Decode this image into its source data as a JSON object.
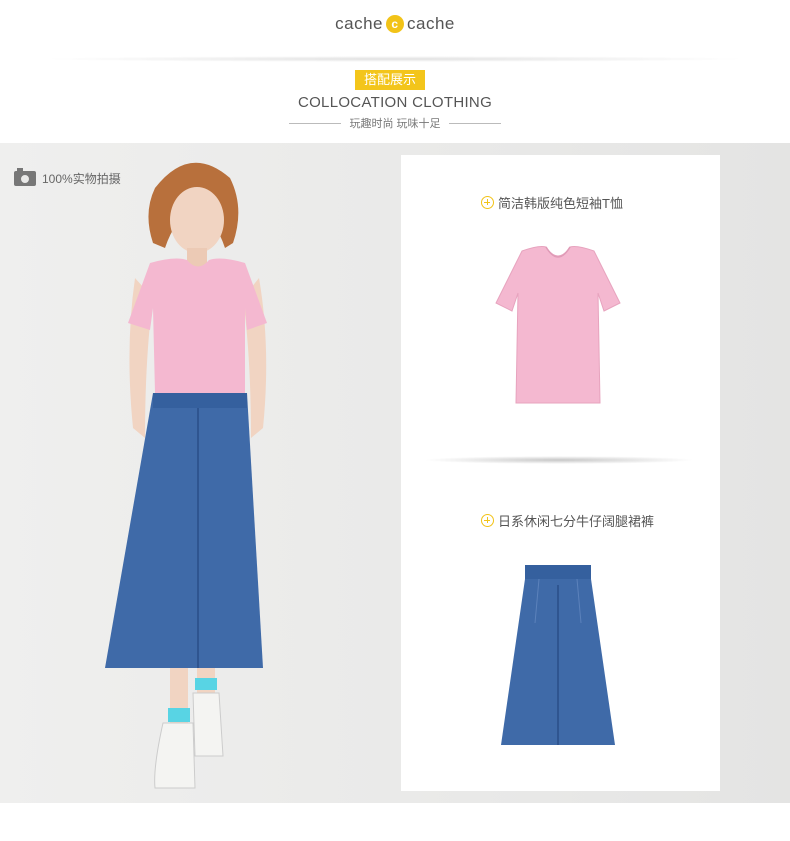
{
  "header": {
    "brand_left": "cache",
    "brand_mark": "c",
    "brand_right": "cache",
    "tag": "搭配展示",
    "title": "COLLOCATION CLOTHING",
    "subtitle": "玩趣时尚 玩味十足"
  },
  "photo": {
    "badge": "100%实物拍摄"
  },
  "products": [
    {
      "name": "简洁韩版纯色短袖T恤",
      "icon": "plus-circle-icon"
    },
    {
      "name": "日系休闲七分牛仔阔腿裙裤",
      "icon": "plus-circle-icon"
    }
  ],
  "colors": {
    "accent": "#f3c51b",
    "tee_pink": "#f4b8d0",
    "denim": "#3f6aa8"
  }
}
